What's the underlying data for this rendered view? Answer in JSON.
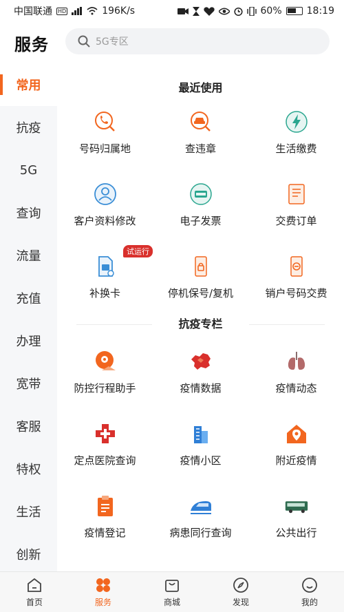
{
  "status": {
    "carrier": "中国联通",
    "hd": "HD",
    "speed": "196K/s",
    "battery": "60%",
    "time": "18:19"
  },
  "header": {
    "title": "服务",
    "search_placeholder": "5G专区"
  },
  "sidebar": {
    "items": [
      "常用",
      "抗疫",
      "5G",
      "查询",
      "流量",
      "充值",
      "办理",
      "宽带",
      "客服",
      "特权",
      "生活",
      "创新"
    ]
  },
  "sections": {
    "recent": {
      "title": "最近使用",
      "items": [
        "号码归属地",
        "查违章",
        "生活缴费",
        "客户资料修改",
        "电子发票",
        "交费订单",
        "补换卡",
        "停机保号/复机",
        "销户号码交费"
      ],
      "trial_tag": "试运行"
    },
    "epidemic": {
      "title": "抗疫专栏",
      "items": [
        "防控行程助手",
        "疫情数据",
        "疫情动态",
        "定点医院查询",
        "疫情小区",
        "附近疫情",
        "疫情登记",
        "病患同行查询",
        "公共出行"
      ]
    }
  },
  "tabbar": {
    "items": [
      "首页",
      "服务",
      "商城",
      "发现",
      "我的"
    ]
  },
  "colors": {
    "accent": "#f2661f",
    "sidebar_bg": "#f6f7f9",
    "tag": "#d9302c"
  }
}
